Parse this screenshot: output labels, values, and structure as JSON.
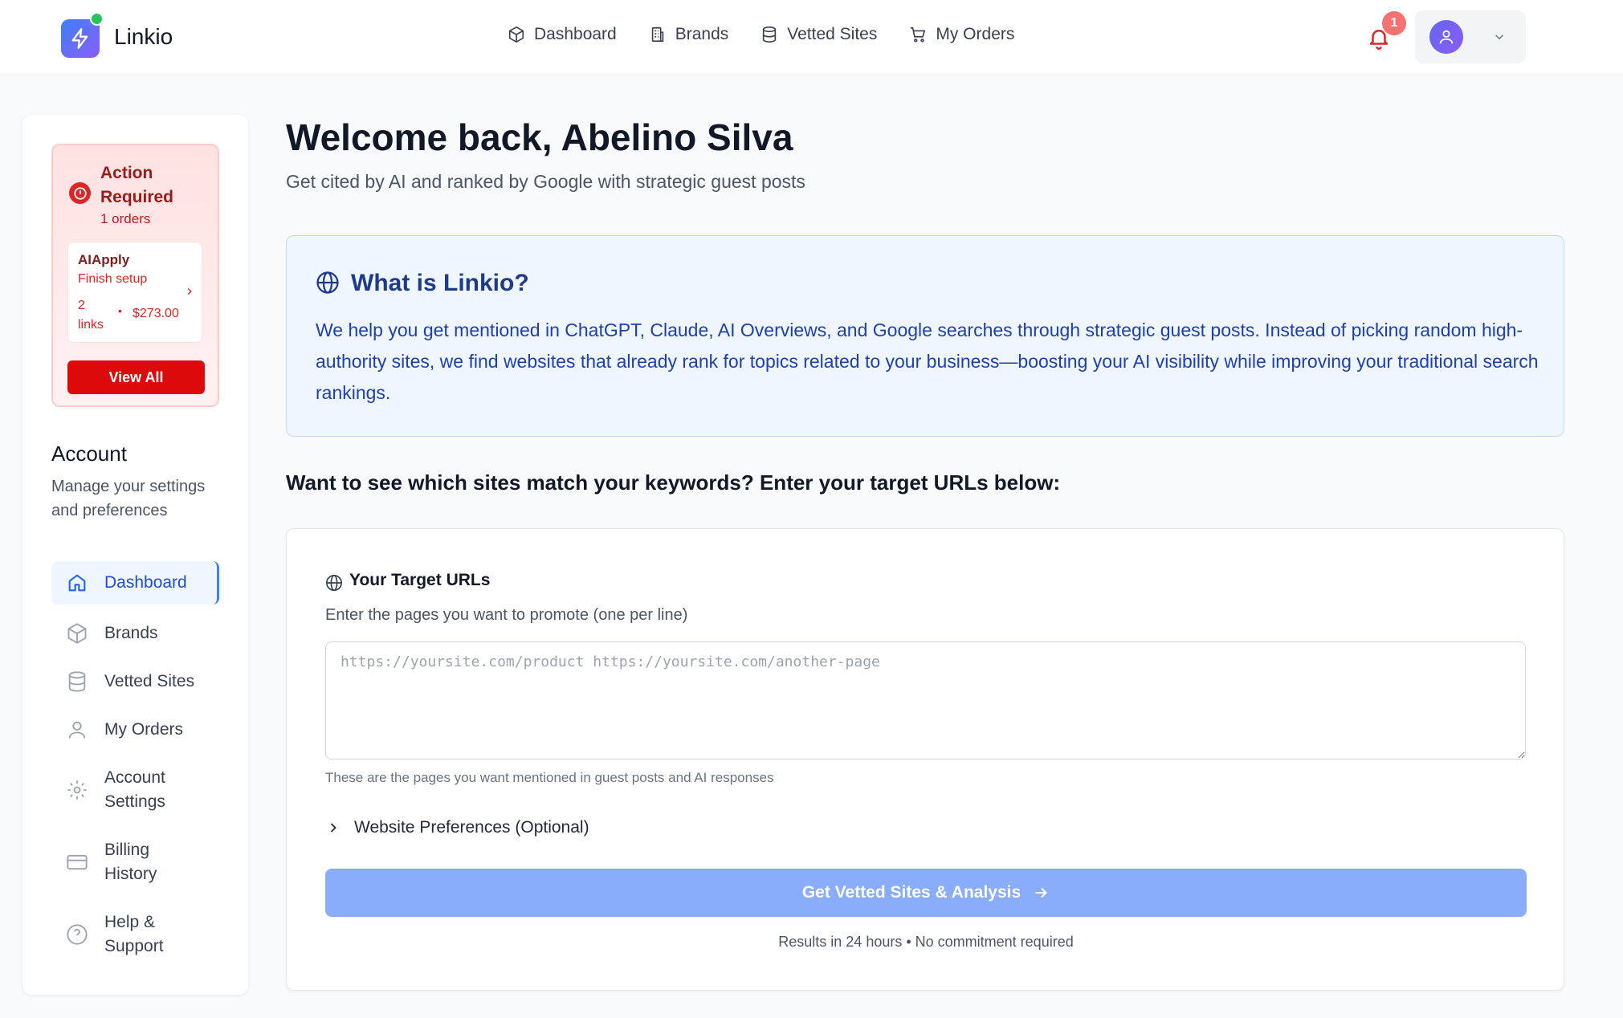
{
  "app": {
    "brand": "Linkio"
  },
  "topnav": {
    "items": [
      {
        "label": "Dashboard",
        "icon": "cube-icon"
      },
      {
        "label": "Brands",
        "icon": "building-icon"
      },
      {
        "label": "Vetted Sites",
        "icon": "database-icon"
      },
      {
        "label": "My Orders",
        "icon": "cart-icon"
      }
    ]
  },
  "notifications": {
    "count": "1"
  },
  "alert": {
    "title": "Action Required",
    "count": "1 orders",
    "order": {
      "name": "AIApply",
      "status": "Finish setup",
      "links": "2 links",
      "separator": "•",
      "price": "$273.00"
    },
    "view_all": "View All"
  },
  "account": {
    "title": "Account",
    "subtitle": "Manage your settings and preferences"
  },
  "sidebar": {
    "items": [
      {
        "label": "Dashboard",
        "icon": "home-icon",
        "active": true
      },
      {
        "label": "Brands",
        "icon": "cube-icon"
      },
      {
        "label": "Vetted Sites",
        "icon": "database-icon"
      },
      {
        "label": "My Orders",
        "icon": "user-icon"
      },
      {
        "label": "Account Settings",
        "icon": "gear-icon"
      },
      {
        "label": "Billing History",
        "icon": "credit-card-icon"
      },
      {
        "label": "Help & Support",
        "icon": "help-circle-icon"
      }
    ]
  },
  "main": {
    "welcome": "Welcome back, Abelino Silva",
    "subtitle": "Get cited by AI and ranked by Google with strategic guest posts",
    "info": {
      "title": "What is Linkio?",
      "body": "We help you get mentioned in ChatGPT, Claude, AI Overviews, and Google searches through strategic guest posts. Instead of picking random high-authority sites, we find websites that already rank for topics related to your business—boosting your AI visibility while improving your traditional search rankings."
    },
    "cta_question": "Want to see which sites match your keywords? Enter your target URLs below:"
  },
  "form": {
    "label": "Your Target URLs",
    "help": "Enter the pages you want to promote (one per line)",
    "placeholder": "https://yoursite.com/product https://yoursite.com/another-page",
    "value": "",
    "note": "These are the pages you want mentioned in guest posts and AI responses",
    "preferences": "Website Preferences (Optional)",
    "submit": "Get Vetted Sites & Analysis",
    "submit_note": "Results in 24 hours • No commitment required"
  },
  "colors": {
    "accent": "#3b82f6",
    "danger": "#dc0a0a",
    "info_bg": "#eff6ff",
    "submit_disabled": "#8aadfb"
  }
}
